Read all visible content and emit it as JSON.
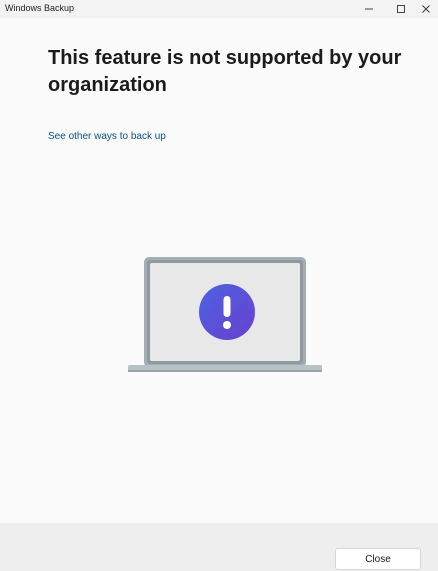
{
  "window": {
    "title": "Windows Backup"
  },
  "titlebar": {
    "minimize_icon": "minimize-icon",
    "maximize_icon": "maximize-icon",
    "close_icon": "close-icon"
  },
  "main": {
    "heading": "This feature is not supported by your organization",
    "link": "See other ways to back up"
  },
  "illustration": {
    "icon": "laptop-warning-icon",
    "badge_icon": "exclamation-icon",
    "badge_colors": [
      "#4b64e0",
      "#6a3fcf"
    ],
    "screen_frame_color": "#9aa7ad",
    "screen_color": "#e8e8e8"
  },
  "footer": {
    "close_label": "Close"
  },
  "colors": {
    "link": "#0c4f86",
    "background": "#fafafa",
    "footer": "#eeeeee"
  }
}
